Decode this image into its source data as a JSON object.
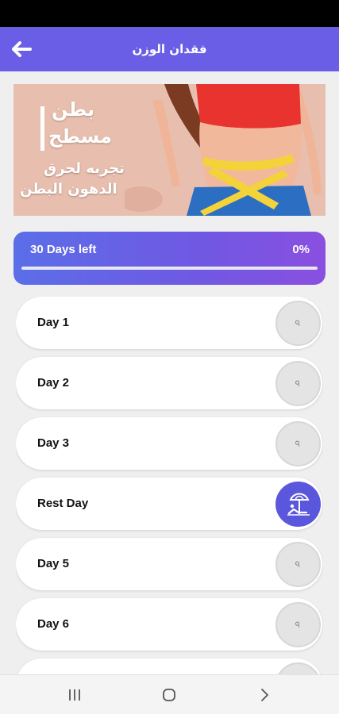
{
  "app_bar": {
    "title": "فقدان الوزن",
    "back_icon": "arrow-left-icon",
    "color": "#6a5ee6"
  },
  "banner": {
    "line1": "بطن",
    "line2": "مسطح",
    "line3": "تجربه لحرق",
    "line4": "الدهون البطن"
  },
  "progress": {
    "left_label": "30 Days left",
    "percent_label": "0%",
    "value": 0
  },
  "days": [
    {
      "label": "Day 1",
      "icon": "dumbbell-icon"
    },
    {
      "label": "Day 2",
      "icon": "dumbbell-icon"
    },
    {
      "label": "Day 3",
      "icon": "dumbbell-icon"
    },
    {
      "label": "Rest Day",
      "icon": "beach-umbrella-icon"
    },
    {
      "label": "Day 5",
      "icon": "dumbbell-icon"
    },
    {
      "label": "Day 6",
      "icon": "dumbbell-icon"
    },
    {
      "label": "",
      "icon": "dumbbell-icon"
    }
  ],
  "nav": {
    "recents_icon": "recents-icon",
    "home_icon": "home-icon",
    "back_icon": "back-chevron-icon"
  }
}
